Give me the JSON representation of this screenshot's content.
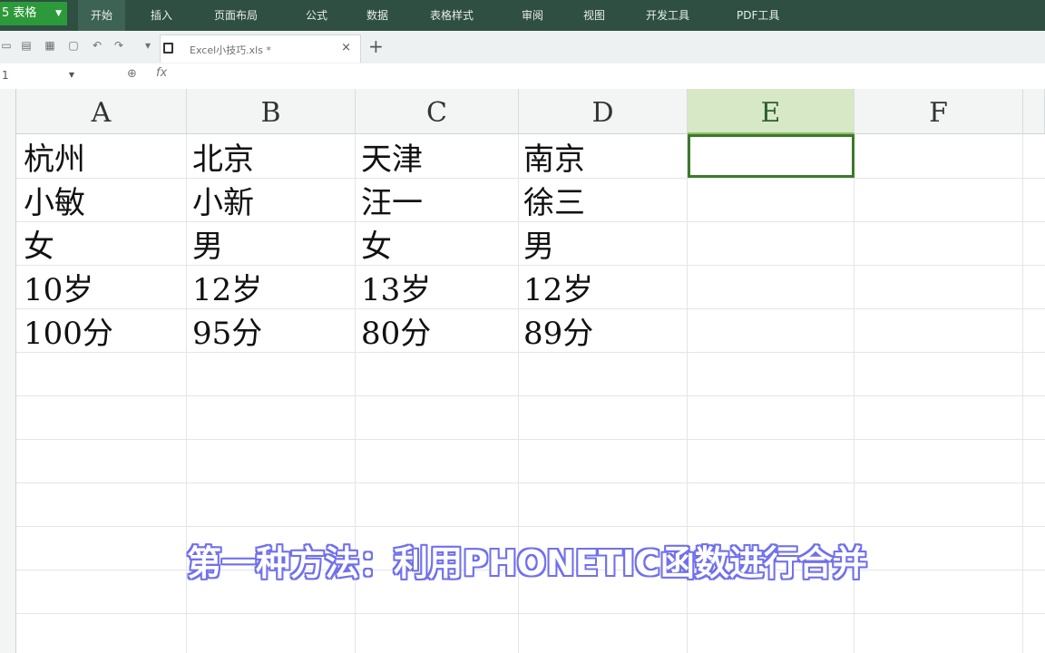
{
  "menubar": {
    "app_label": "5 表格",
    "items": [
      {
        "label": "开始"
      },
      {
        "label": "插入"
      },
      {
        "label": "页面布局"
      },
      {
        "label": "公式"
      },
      {
        "label": "数据"
      },
      {
        "label": "表格样式"
      },
      {
        "label": "审阅"
      },
      {
        "label": "视图"
      },
      {
        "label": "开发工具"
      },
      {
        "label": "PDF工具"
      }
    ],
    "active_item": "开始",
    "bar_color": "#2f4f43",
    "app_color": "#2c9a3a"
  },
  "tabs": {
    "document_name": "Excel小技巧.xls *",
    "close_glyph": "×",
    "add_glyph": "+"
  },
  "formula_bar": {
    "name_box": "1",
    "fx": "fx"
  },
  "sheet": {
    "columns": [
      "A",
      "B",
      "C",
      "D",
      "E",
      "F"
    ],
    "selected_column": "E",
    "rows": [
      [
        "杭州",
        "北京",
        "天津",
        "南京"
      ],
      [
        "小敏",
        "小新",
        "汪一",
        "徐三"
      ],
      [
        "女",
        "男",
        "女",
        "男"
      ],
      [
        "10岁",
        "12岁",
        "13岁",
        "12岁"
      ],
      [
        "100分",
        "95分",
        "80分",
        "89分"
      ]
    ],
    "selection_color": "#3b7a2a"
  },
  "subtitle": "第一种方法：利用PHONETIC函数进行合并"
}
